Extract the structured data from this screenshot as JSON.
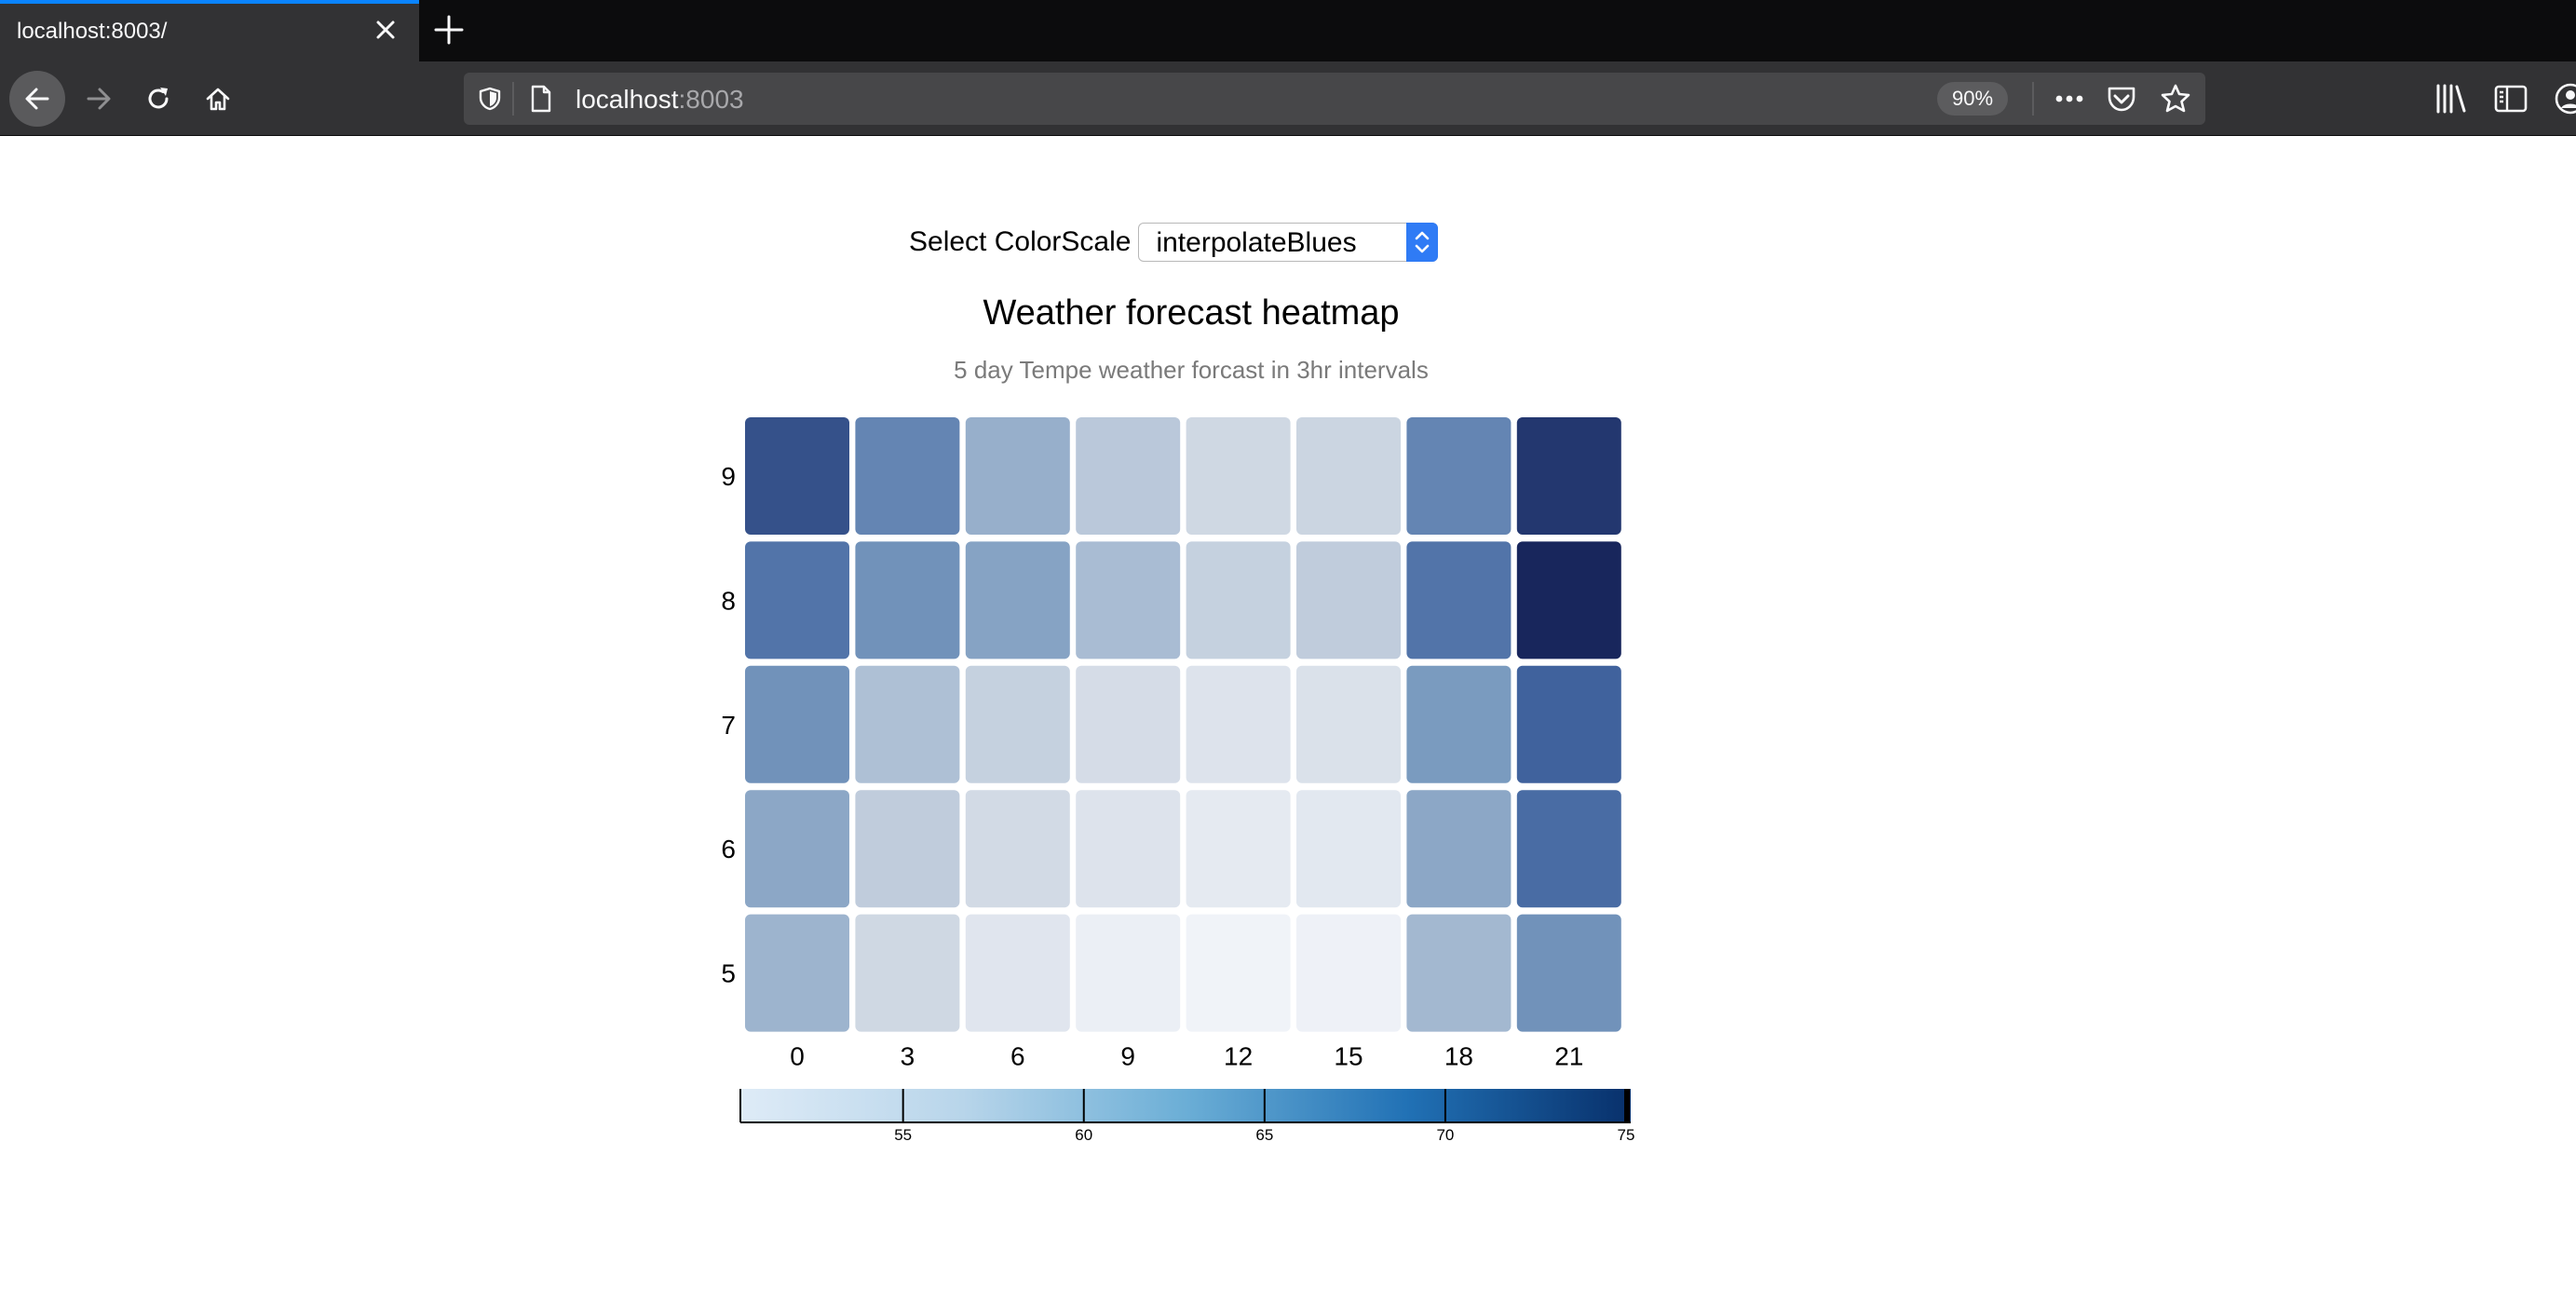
{
  "browser": {
    "tab_title": "localhost:8003/",
    "url_host": "localhost",
    "url_port": ":8003",
    "zoom": "90%"
  },
  "icons": {
    "back": "back-arrow-icon",
    "forward": "forward-arrow-icon",
    "reload": "reload-icon",
    "home": "home-icon",
    "shield": "tracking-shield-icon",
    "page": "page-icon",
    "more": "more-dots-icon",
    "pocket": "pocket-icon",
    "star": "bookmark-star-icon",
    "library": "library-icon",
    "sidebar": "sidebar-icon",
    "account": "account-icon",
    "close": "close-icon",
    "new_tab": "plus-icon"
  },
  "controls": {
    "select_label": "Select ColorScale",
    "select_value": "interpolateBlues"
  },
  "chart_data": {
    "type": "heatmap",
    "title": "Weather forecast heatmap",
    "subtitle": "5 day Tempe weather forcast in 3hr intervals",
    "x_categories": [
      "0",
      "3",
      "6",
      "9",
      "12",
      "15",
      "18",
      "21"
    ],
    "y_categories": [
      "9",
      "8",
      "7",
      "6",
      "5"
    ],
    "values": [
      [
        72.5,
        67.5,
        62.5,
        59.5,
        57.5,
        58.0,
        67.5,
        74.0
      ],
      [
        69.5,
        66.0,
        64.0,
        61.0,
        58.5,
        59.0,
        69.5,
        76.0
      ],
      [
        66.0,
        60.5,
        58.5,
        56.5,
        55.0,
        55.5,
        65.0,
        71.5
      ],
      [
        63.5,
        59.0,
        57.0,
        55.0,
        53.5,
        54.0,
        63.5,
        70.5
      ],
      [
        62.0,
        57.5,
        54.5,
        52.5,
        51.5,
        52.0,
        61.5,
        66.0
      ]
    ],
    "color_scale": "interpolateBlues",
    "legend": {
      "ticks": [
        55,
        60,
        65,
        70,
        75
      ],
      "domain": [
        50.5,
        75
      ],
      "placement": "bottom"
    }
  }
}
